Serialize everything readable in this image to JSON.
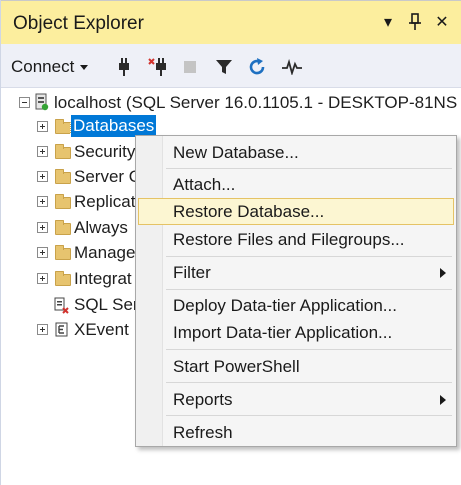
{
  "panel": {
    "title": "Object Explorer",
    "title_buttons": {
      "dropdown": "▾",
      "pin": "⊥",
      "close": "✕"
    }
  },
  "toolbar": {
    "connect_label": "Connect",
    "icons": [
      "connect-icon",
      "disconnect-icon",
      "stop-icon",
      "filter-icon",
      "refresh-icon",
      "activity-monitor-icon"
    ]
  },
  "tree": {
    "root_label": "localhost (SQL Server 16.0.1105.1 - DESKTOP-81NS",
    "items": [
      {
        "label": "Databases"
      },
      {
        "label": "Security"
      },
      {
        "label": "Server O"
      },
      {
        "label": "Replicat"
      },
      {
        "label": "Always"
      },
      {
        "label": "Manage"
      },
      {
        "label": "Integrat"
      },
      {
        "label": "SQL Ser"
      },
      {
        "label": "XEvent"
      }
    ]
  },
  "context_menu": {
    "items": [
      {
        "label": "New Database..."
      },
      {
        "label": "Attach..."
      },
      {
        "label": "Restore Database..."
      },
      {
        "label": "Restore Files and Filegroups..."
      },
      {
        "label": "Filter"
      },
      {
        "label": "Deploy Data-tier Application..."
      },
      {
        "label": "Import Data-tier Application..."
      },
      {
        "label": "Start PowerShell"
      },
      {
        "label": "Reports"
      },
      {
        "label": "Refresh"
      }
    ]
  },
  "colors": {
    "title_bar": "#fcee9e",
    "selection": "#0078d7",
    "menu_hover": "#fcf6d2"
  }
}
